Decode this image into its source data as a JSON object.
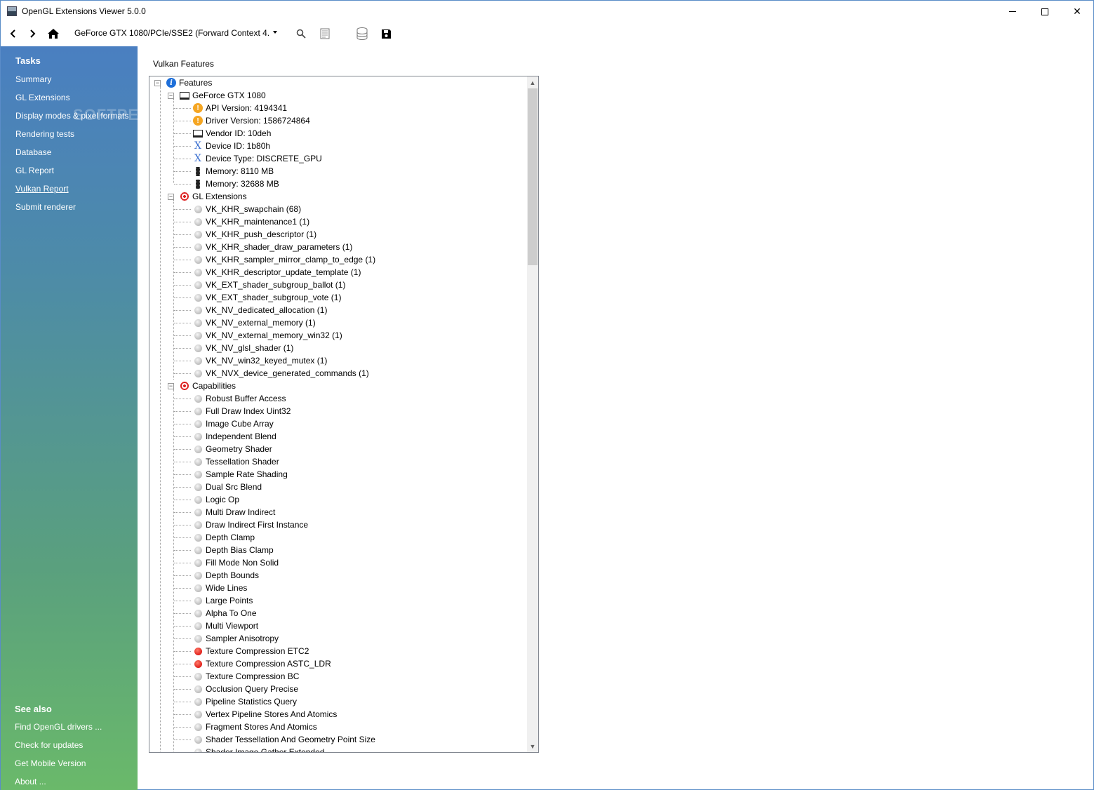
{
  "window": {
    "title": "OpenGL Extensions Viewer 5.0.0"
  },
  "toolbar": {
    "device": "GeForce GTX 1080/PCIe/SSE2  (Forward  Context 4."
  },
  "sidebar": {
    "tasks_heading": "Tasks",
    "items": [
      {
        "label": "Summary"
      },
      {
        "label": "GL Extensions"
      },
      {
        "label": "Display modes & pixel formats"
      },
      {
        "label": "Rendering tests"
      },
      {
        "label": "Database"
      },
      {
        "label": "GL Report"
      },
      {
        "label": "Vulkan Report"
      },
      {
        "label": "Submit renderer"
      }
    ],
    "see_also_heading": "See also",
    "links": [
      {
        "label": "Find OpenGL drivers ..."
      },
      {
        "label": "Check for updates"
      },
      {
        "label": "Get Mobile Version"
      },
      {
        "label": "About ..."
      }
    ],
    "watermark": "SOFTPEDIA"
  },
  "main": {
    "title": "Vulkan Features"
  },
  "tree": {
    "root": "Features",
    "device": "GeForce GTX 1080",
    "device_props": [
      {
        "icon": "warn",
        "label": "API Version: 4194341"
      },
      {
        "icon": "warn",
        "label": "Driver Version: 1586724864"
      },
      {
        "icon": "monitor",
        "label": "Vendor ID: 10deh"
      },
      {
        "icon": "x",
        "label": "Device ID: 1b80h"
      },
      {
        "icon": "x",
        "label": "Device Type: DISCRETE_GPU"
      },
      {
        "icon": "mem",
        "label": "Memory: 8110 MB"
      },
      {
        "icon": "mem",
        "label": "Memory: 32688 MB"
      }
    ],
    "gl_extensions_label": "GL Extensions",
    "extensions": [
      "VK_KHR_swapchain (68)",
      "VK_KHR_maintenance1 (1)",
      "VK_KHR_push_descriptor (1)",
      "VK_KHR_shader_draw_parameters (1)",
      "VK_KHR_sampler_mirror_clamp_to_edge (1)",
      "VK_KHR_descriptor_update_template (1)",
      "VK_EXT_shader_subgroup_ballot (1)",
      "VK_EXT_shader_subgroup_vote (1)",
      "VK_NV_dedicated_allocation (1)",
      "VK_NV_external_memory (1)",
      "VK_NV_external_memory_win32 (1)",
      "VK_NV_glsl_shader (1)",
      "VK_NV_win32_keyed_mutex (1)",
      "VK_NVX_device_generated_commands (1)"
    ],
    "capabilities_label": "Capabilities",
    "capabilities": [
      {
        "label": "Robust Buffer Access",
        "status": "grey"
      },
      {
        "label": "Full Draw Index Uint32",
        "status": "grey"
      },
      {
        "label": "Image Cube Array",
        "status": "grey"
      },
      {
        "label": "Independent Blend",
        "status": "grey"
      },
      {
        "label": "Geometry Shader",
        "status": "grey"
      },
      {
        "label": "Tessellation Shader",
        "status": "grey"
      },
      {
        "label": "Sample Rate Shading",
        "status": "grey"
      },
      {
        "label": "Dual Src Blend",
        "status": "grey"
      },
      {
        "label": "Logic Op",
        "status": "grey"
      },
      {
        "label": "Multi Draw Indirect",
        "status": "grey"
      },
      {
        "label": "Draw Indirect First Instance",
        "status": "grey"
      },
      {
        "label": "Depth Clamp",
        "status": "grey"
      },
      {
        "label": "Depth Bias Clamp",
        "status": "grey"
      },
      {
        "label": "Fill Mode Non Solid",
        "status": "grey"
      },
      {
        "label": "Depth Bounds",
        "status": "grey"
      },
      {
        "label": "Wide Lines",
        "status": "grey"
      },
      {
        "label": "Large Points",
        "status": "grey"
      },
      {
        "label": "Alpha To One",
        "status": "grey"
      },
      {
        "label": "Multi Viewport",
        "status": "grey"
      },
      {
        "label": "Sampler Anisotropy",
        "status": "grey"
      },
      {
        "label": "Texture Compression ETC2",
        "status": "red"
      },
      {
        "label": "Texture Compression ASTC_LDR",
        "status": "red"
      },
      {
        "label": "Texture Compression BC",
        "status": "grey"
      },
      {
        "label": "Occlusion Query Precise",
        "status": "grey"
      },
      {
        "label": "Pipeline Statistics Query",
        "status": "grey"
      },
      {
        "label": "Vertex Pipeline Stores And Atomics",
        "status": "grey"
      },
      {
        "label": "Fragment Stores And Atomics",
        "status": "grey"
      },
      {
        "label": "Shader Tessellation And Geometry Point Size",
        "status": "grey"
      },
      {
        "label": "Shader Image Gather Extended",
        "status": "grey"
      }
    ]
  },
  "colors": {
    "sidebar_top": "#4a7fc1",
    "sidebar_bottom": "#6ab96a",
    "info": "#1e6fd9",
    "warn": "#f5a623",
    "unsupported": "#e0201a"
  }
}
